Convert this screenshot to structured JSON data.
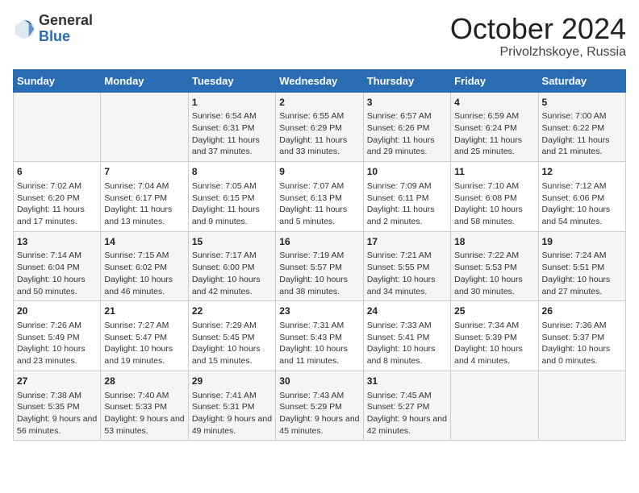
{
  "header": {
    "logo_general": "General",
    "logo_blue": "Blue",
    "month_title": "October 2024",
    "location": "Privolzhskoye, Russia"
  },
  "weekdays": [
    "Sunday",
    "Monday",
    "Tuesday",
    "Wednesday",
    "Thursday",
    "Friday",
    "Saturday"
  ],
  "rows": [
    [
      {
        "day": "",
        "info": ""
      },
      {
        "day": "",
        "info": ""
      },
      {
        "day": "1",
        "info": "Sunrise: 6:54 AM\nSunset: 6:31 PM\nDaylight: 11 hours and 37 minutes."
      },
      {
        "day": "2",
        "info": "Sunrise: 6:55 AM\nSunset: 6:29 PM\nDaylight: 11 hours and 33 minutes."
      },
      {
        "day": "3",
        "info": "Sunrise: 6:57 AM\nSunset: 6:26 PM\nDaylight: 11 hours and 29 minutes."
      },
      {
        "day": "4",
        "info": "Sunrise: 6:59 AM\nSunset: 6:24 PM\nDaylight: 11 hours and 25 minutes."
      },
      {
        "day": "5",
        "info": "Sunrise: 7:00 AM\nSunset: 6:22 PM\nDaylight: 11 hours and 21 minutes."
      }
    ],
    [
      {
        "day": "6",
        "info": "Sunrise: 7:02 AM\nSunset: 6:20 PM\nDaylight: 11 hours and 17 minutes."
      },
      {
        "day": "7",
        "info": "Sunrise: 7:04 AM\nSunset: 6:17 PM\nDaylight: 11 hours and 13 minutes."
      },
      {
        "day": "8",
        "info": "Sunrise: 7:05 AM\nSunset: 6:15 PM\nDaylight: 11 hours and 9 minutes."
      },
      {
        "day": "9",
        "info": "Sunrise: 7:07 AM\nSunset: 6:13 PM\nDaylight: 11 hours and 5 minutes."
      },
      {
        "day": "10",
        "info": "Sunrise: 7:09 AM\nSunset: 6:11 PM\nDaylight: 11 hours and 2 minutes."
      },
      {
        "day": "11",
        "info": "Sunrise: 7:10 AM\nSunset: 6:08 PM\nDaylight: 10 hours and 58 minutes."
      },
      {
        "day": "12",
        "info": "Sunrise: 7:12 AM\nSunset: 6:06 PM\nDaylight: 10 hours and 54 minutes."
      }
    ],
    [
      {
        "day": "13",
        "info": "Sunrise: 7:14 AM\nSunset: 6:04 PM\nDaylight: 10 hours and 50 minutes."
      },
      {
        "day": "14",
        "info": "Sunrise: 7:15 AM\nSunset: 6:02 PM\nDaylight: 10 hours and 46 minutes."
      },
      {
        "day": "15",
        "info": "Sunrise: 7:17 AM\nSunset: 6:00 PM\nDaylight: 10 hours and 42 minutes."
      },
      {
        "day": "16",
        "info": "Sunrise: 7:19 AM\nSunset: 5:57 PM\nDaylight: 10 hours and 38 minutes."
      },
      {
        "day": "17",
        "info": "Sunrise: 7:21 AM\nSunset: 5:55 PM\nDaylight: 10 hours and 34 minutes."
      },
      {
        "day": "18",
        "info": "Sunrise: 7:22 AM\nSunset: 5:53 PM\nDaylight: 10 hours and 30 minutes."
      },
      {
        "day": "19",
        "info": "Sunrise: 7:24 AM\nSunset: 5:51 PM\nDaylight: 10 hours and 27 minutes."
      }
    ],
    [
      {
        "day": "20",
        "info": "Sunrise: 7:26 AM\nSunset: 5:49 PM\nDaylight: 10 hours and 23 minutes."
      },
      {
        "day": "21",
        "info": "Sunrise: 7:27 AM\nSunset: 5:47 PM\nDaylight: 10 hours and 19 minutes."
      },
      {
        "day": "22",
        "info": "Sunrise: 7:29 AM\nSunset: 5:45 PM\nDaylight: 10 hours and 15 minutes."
      },
      {
        "day": "23",
        "info": "Sunrise: 7:31 AM\nSunset: 5:43 PM\nDaylight: 10 hours and 11 minutes."
      },
      {
        "day": "24",
        "info": "Sunrise: 7:33 AM\nSunset: 5:41 PM\nDaylight: 10 hours and 8 minutes."
      },
      {
        "day": "25",
        "info": "Sunrise: 7:34 AM\nSunset: 5:39 PM\nDaylight: 10 hours and 4 minutes."
      },
      {
        "day": "26",
        "info": "Sunrise: 7:36 AM\nSunset: 5:37 PM\nDaylight: 10 hours and 0 minutes."
      }
    ],
    [
      {
        "day": "27",
        "info": "Sunrise: 7:38 AM\nSunset: 5:35 PM\nDaylight: 9 hours and 56 minutes."
      },
      {
        "day": "28",
        "info": "Sunrise: 7:40 AM\nSunset: 5:33 PM\nDaylight: 9 hours and 53 minutes."
      },
      {
        "day": "29",
        "info": "Sunrise: 7:41 AM\nSunset: 5:31 PM\nDaylight: 9 hours and 49 minutes."
      },
      {
        "day": "30",
        "info": "Sunrise: 7:43 AM\nSunset: 5:29 PM\nDaylight: 9 hours and 45 minutes."
      },
      {
        "day": "31",
        "info": "Sunrise: 7:45 AM\nSunset: 5:27 PM\nDaylight: 9 hours and 42 minutes."
      },
      {
        "day": "",
        "info": ""
      },
      {
        "day": "",
        "info": ""
      }
    ]
  ]
}
